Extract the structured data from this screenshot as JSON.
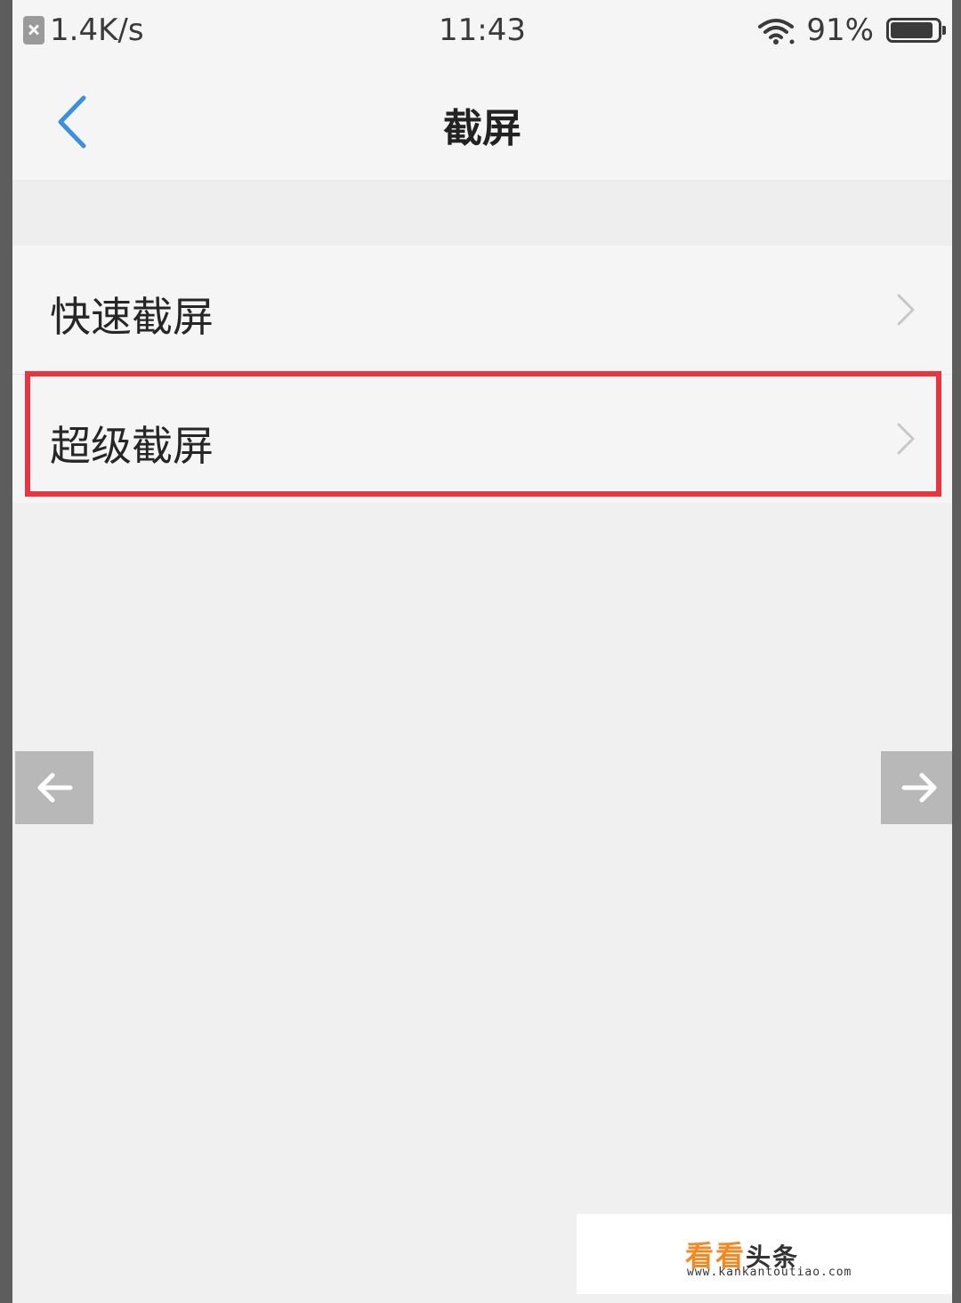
{
  "statusbar": {
    "network_speed": "1.4K/s",
    "time": "11:43",
    "battery_percent": "91%",
    "battery_level": 0.91
  },
  "header": {
    "title": "截屏"
  },
  "list": {
    "items": [
      {
        "label": "快速截屏"
      },
      {
        "label": "超级截屏"
      }
    ]
  },
  "colors": {
    "accent": "#3b8fe0",
    "highlight": "#e8353f",
    "watermark_orange": "#f08a24"
  },
  "watermark": {
    "brand_main": "看看",
    "brand_sub": "头条",
    "url": "www.kankantoutiao.com"
  }
}
